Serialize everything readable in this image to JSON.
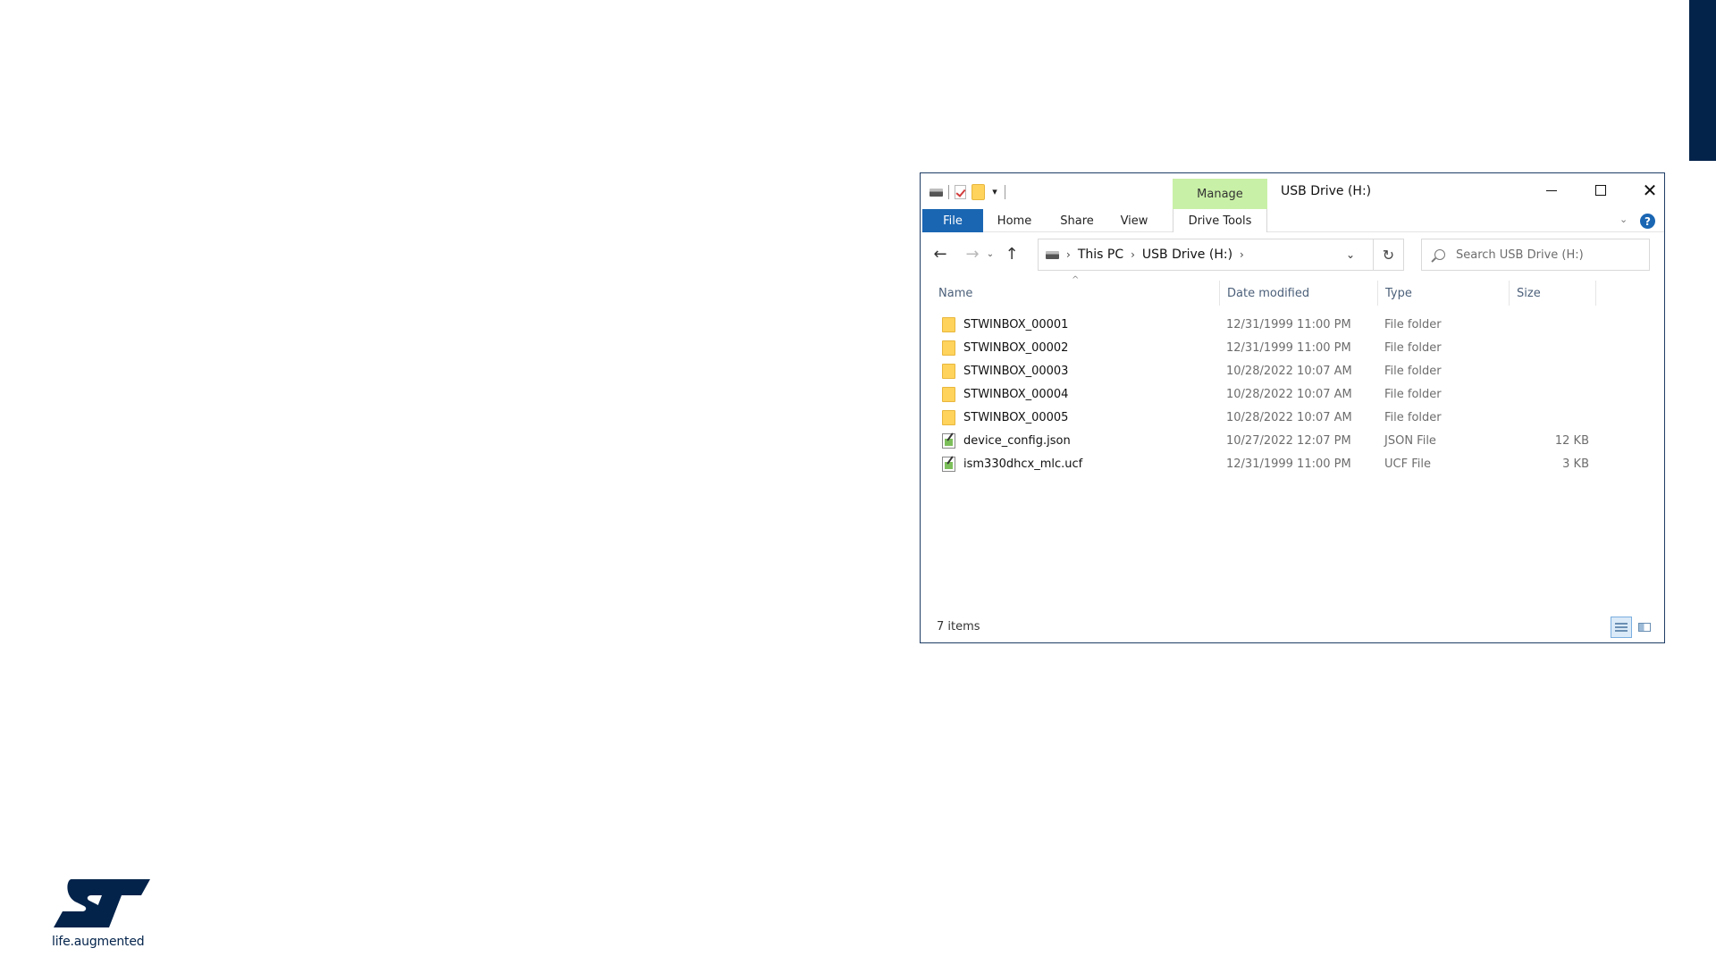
{
  "slide": {
    "accent_color": "#03234b",
    "logo": {
      "tagline": "life.augmented",
      "color": "#03234b"
    }
  },
  "window": {
    "title": "USB Drive (H:)",
    "context_tab": "Manage",
    "context_tab_color": "#c9f0a7",
    "accent_color": "#1a66b3",
    "quick_access_icons": [
      "drive-icon",
      "properties-icon",
      "new-folder-icon",
      "customize-dropdown-icon"
    ],
    "controls": {
      "minimize": "minimize-icon",
      "maximize": "maximize-icon",
      "close": "✕"
    }
  },
  "ribbon": {
    "tabs": [
      "File",
      "Home",
      "Share",
      "View",
      "Drive Tools"
    ],
    "active_tab": "File",
    "help_label": "?"
  },
  "nav": {
    "back": "←",
    "forward": "→",
    "recent": "⌄",
    "up": "↑",
    "breadcrumb": [
      "This PC",
      "USB Drive (H:)"
    ],
    "separator": "›",
    "refresh": "↻",
    "search_placeholder": "Search USB Drive (H:)"
  },
  "columns": {
    "name": "Name",
    "date": "Date modified",
    "type": "Type",
    "size": "Size",
    "sorted_by": "Name",
    "sort_indicator": "^"
  },
  "files": [
    {
      "name": "STWINBOX_00001",
      "date": "12/31/1999 11:00 PM",
      "type": "File folder",
      "size": "",
      "icon": "folder-icon"
    },
    {
      "name": "STWINBOX_00002",
      "date": "12/31/1999 11:00 PM",
      "type": "File folder",
      "size": "",
      "icon": "folder-icon"
    },
    {
      "name": "STWINBOX_00003",
      "date": "10/28/2022 10:07 AM",
      "type": "File folder",
      "size": "",
      "icon": "folder-icon"
    },
    {
      "name": "STWINBOX_00004",
      "date": "10/28/2022 10:07 AM",
      "type": "File folder",
      "size": "",
      "icon": "folder-icon"
    },
    {
      "name": "STWINBOX_00005",
      "date": "10/28/2022 10:07 AM",
      "type": "File folder",
      "size": "",
      "icon": "folder-icon"
    },
    {
      "name": "device_config.json",
      "date": "10/27/2022 12:07 PM",
      "type": "JSON File",
      "size": "12 KB",
      "icon": "file-icon"
    },
    {
      "name": "ism330dhcx_mlc.ucf",
      "date": "12/31/1999 11:00 PM",
      "type": "UCF File",
      "size": "3 KB",
      "icon": "file-icon"
    }
  ],
  "status": {
    "items": "7 items",
    "active_view": "details"
  }
}
